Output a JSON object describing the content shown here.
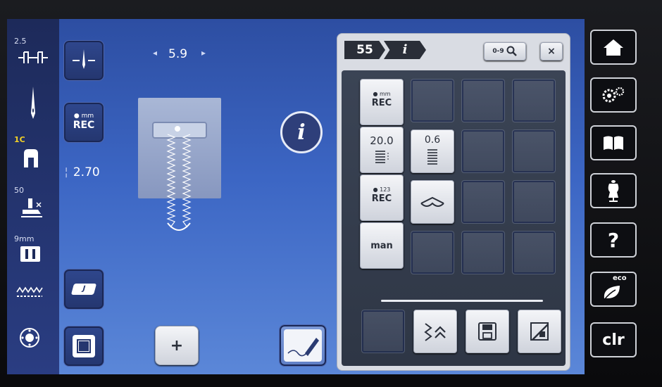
{
  "left_sidebar": {
    "stitch_width_value": "2.5",
    "presser_foot_value": "1C",
    "foot_pressure_value": "50",
    "needle_plate_value": "9mm"
  },
  "main": {
    "stitch_length_value": "5.9",
    "rec_label": "REC",
    "rec_unit": "mm",
    "length_readout": "2.70",
    "foot_label": "J"
  },
  "panel": {
    "pattern_number": "55",
    "info_tab": "i",
    "search_label": "0-9",
    "close_label": "×",
    "side_buttons": [
      {
        "unit": "mm",
        "label": "REC"
      },
      {
        "value": "20.0"
      },
      {
        "unit": "123",
        "label": "REC"
      },
      {
        "label": "man"
      }
    ],
    "density_value": "0.6"
  },
  "right_bar": {
    "eco_label": "eco",
    "clr_label": "clr",
    "help_label": "?"
  },
  "colors": {
    "screen_blue": "#3c66c4",
    "accent_yellow": "#f4d225"
  }
}
